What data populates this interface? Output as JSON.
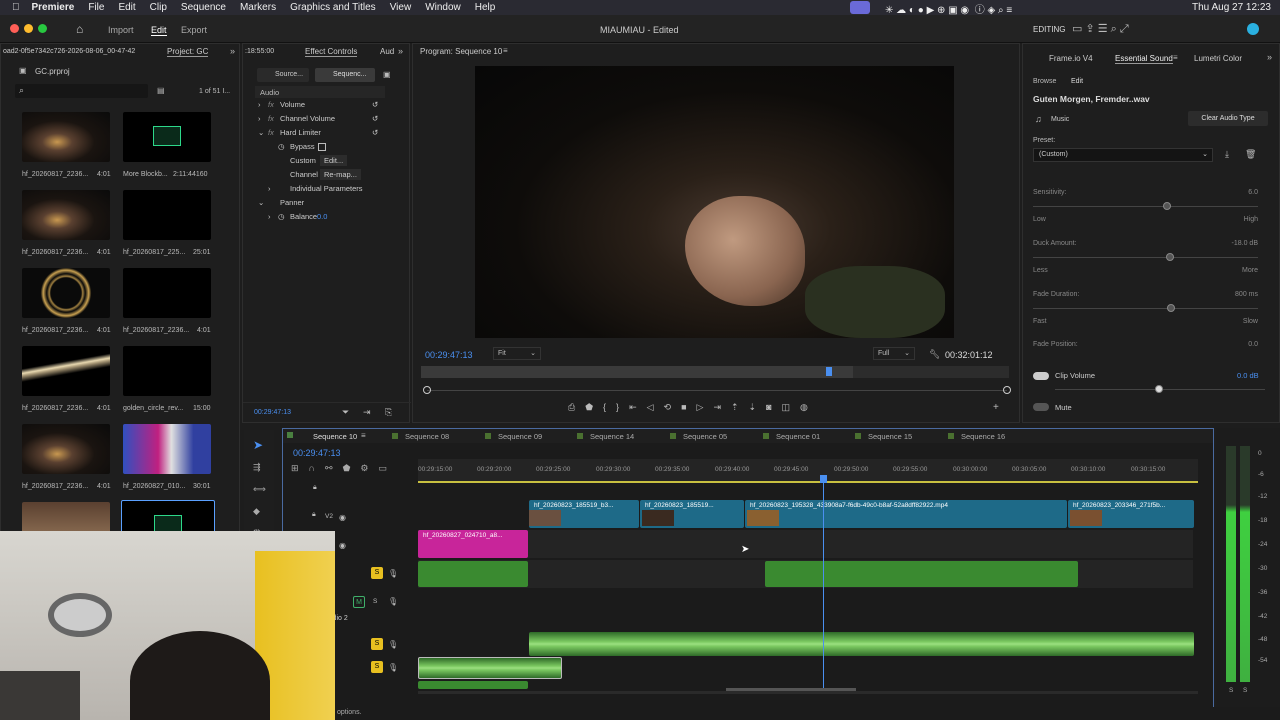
{
  "menubar": {
    "app": "Premiere",
    "items": [
      "File",
      "Edit",
      "Clip",
      "Sequence",
      "Markers",
      "Graphics and Titles",
      "View",
      "Window",
      "Help"
    ],
    "clock": "Thu Aug 27  12:23"
  },
  "titlebar": {
    "home_tabs": [
      "Import",
      "Edit",
      "Export"
    ],
    "active_tab": "Edit",
    "title": "MIAUMIAU - Edited",
    "workspace": "EDITING"
  },
  "project": {
    "breadcrumb": "oad2-0f5e7342c726-2026-08-06_00-47-42",
    "project_tab": "Project: GC",
    "file": "GC.prproj",
    "count": "1 of 51 I...",
    "items": [
      {
        "name": "hf_20260817_2236...",
        "dur": "4:01"
      },
      {
        "name": "More Blockb...",
        "dur": "2:11:44160"
      },
      {
        "name": "hf_20260817_2236...",
        "dur": "4:01"
      },
      {
        "name": "hf_20260817_225...",
        "dur": "25:01"
      },
      {
        "name": "hf_20260817_2236...",
        "dur": "4:01"
      },
      {
        "name": "hf_20260817_2236...",
        "dur": "4:01"
      },
      {
        "name": "hf_20260817_2236...",
        "dur": "4:01"
      },
      {
        "name": "golden_circle_rev...",
        "dur": "15:00"
      },
      {
        "name": "hf_20260817_2236...",
        "dur": "4:01"
      },
      {
        "name": "hf_20260827_010...",
        "dur": "30:01"
      }
    ]
  },
  "effect_controls": {
    "timecode_top": ":18:55:00",
    "tab": "Effect Controls",
    "tab2": "Aud",
    "source_btn": "Source...",
    "sequence_btn": "Sequenc...",
    "section": "Audio",
    "rows": [
      "Volume",
      "Channel Volume",
      "Hard Limiter",
      "Bypass",
      "Custom",
      "Channel",
      "Individual Parameters",
      "Panner",
      "Balance"
    ],
    "custom_btn": "Edit...",
    "channel_btn": "Re-map...",
    "balance_val": "0.0",
    "timecode": "00:29:47:13"
  },
  "program": {
    "title": "Program: Sequence 10",
    "timecode": "00:29:47:13",
    "fit": "Fit",
    "quality": "Full",
    "duration": "00:32:01:12"
  },
  "essential_sound": {
    "tabs": [
      "Frame.io V4",
      "Essential Sound",
      "Lumetri Color"
    ],
    "sub_tabs": [
      "Browse",
      "Edit"
    ],
    "clip_name": "Guten Morgen, Fremder..wav",
    "type": "Music",
    "clear_btn": "Clear Audio Type",
    "preset_label": "Preset:",
    "preset_value": "(Custom)",
    "sensitivity": {
      "label": "Sensitivity:",
      "value": "6.0",
      "low": "Low",
      "high": "High"
    },
    "duck": {
      "label": "Duck Amount:",
      "value": "-18.0 dB",
      "low": "Less",
      "high": "More"
    },
    "fade": {
      "label": "Fade Duration:",
      "value": "800 ms",
      "low": "Fast",
      "high": "Slow"
    },
    "fade_pos": {
      "label": "Fade Position:",
      "value": "0.0"
    },
    "clip_volume": {
      "label": "Clip Volume",
      "value": "0.0 dB"
    },
    "mute": "Mute"
  },
  "timeline": {
    "tabs": [
      "Sequence 10",
      "Sequence 08",
      "Sequence 09",
      "Sequence 14",
      "Sequence 05",
      "Sequence 01",
      "Sequence 15",
      "Sequence 16"
    ],
    "timecode": "00:29:47:13",
    "ruler": [
      "00:29:15:00",
      "00:29:20:00",
      "00:29:25:00",
      "00:29:30:00",
      "00:29:35:00",
      "00:29:40:00",
      "00:29:45:00",
      "00:29:50:00",
      "00:29:55:00",
      "00:30:00:00",
      "00:30:05:00",
      "00:30:10:00",
      "00:30:15:00"
    ],
    "tracks": [
      "V3",
      "V2",
      "V1",
      "A1",
      "A2",
      "A3",
      "A4"
    ],
    "audio2_label": "Audio 2",
    "clips": {
      "v2_a": "hf_20260823_185519_b3...",
      "v2_b": "hf_20260823_185519...",
      "v2_c": "hf_20260823_195328_433908a7-f6db-49c0-b8af-52a8dff82922.mp4",
      "v2_d": "hf_20260823_203346_271f5b...",
      "v1_a": "hf_20260827_024710_a8..."
    }
  },
  "meter": {
    "labels": [
      "0",
      "-6",
      "-12",
      "-18",
      "-24",
      "-30",
      "-36",
      "-42",
      "-48",
      "-54"
    ],
    "bottom": [
      "S",
      "S"
    ]
  },
  "status": "options."
}
